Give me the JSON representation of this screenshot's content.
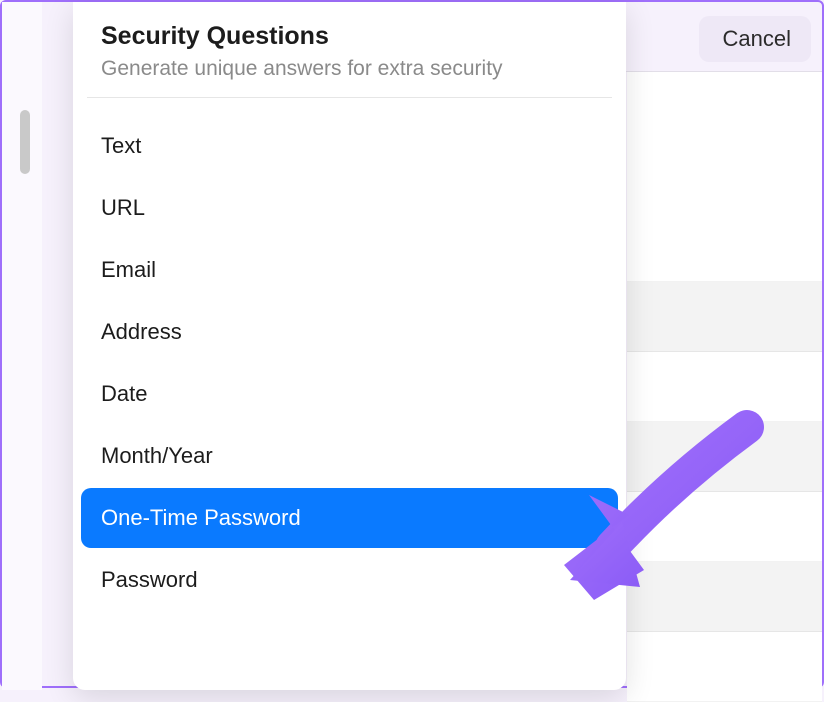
{
  "cancel_label": "Cancel",
  "header": {
    "title": "Security Questions",
    "subtitle": "Generate unique answers for extra security"
  },
  "field_types": [
    {
      "label": "Text",
      "selected": false
    },
    {
      "label": "URL",
      "selected": false
    },
    {
      "label": "Email",
      "selected": false
    },
    {
      "label": "Address",
      "selected": false
    },
    {
      "label": "Date",
      "selected": false
    },
    {
      "label": "Month/Year",
      "selected": false
    },
    {
      "label": "One-Time Password",
      "selected": true
    },
    {
      "label": "Password",
      "selected": false
    }
  ],
  "colors": {
    "accent_purple": "#9f6ffb",
    "selection_blue": "#0a7aff"
  }
}
